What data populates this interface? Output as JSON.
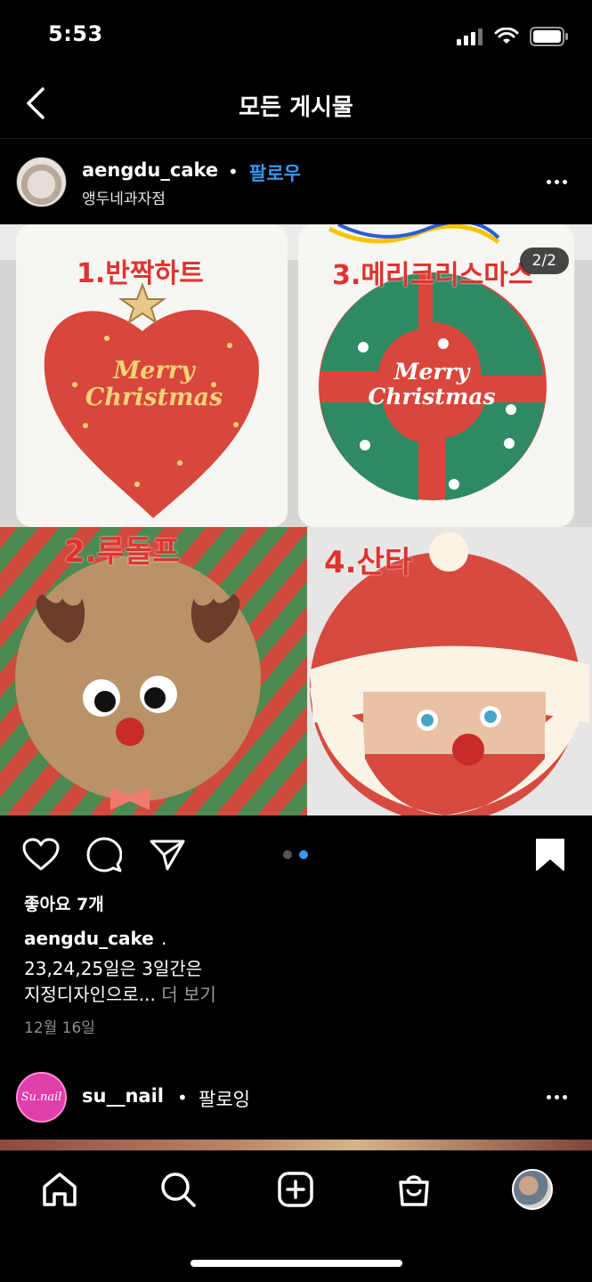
{
  "status_bar": {
    "time": "5:53"
  },
  "nav": {
    "title": "모든 게시물"
  },
  "post": {
    "username": "aengdu_cake",
    "separator": "•",
    "follow_label": "팔로우",
    "location": "앵두네과자점",
    "image": {
      "page_indicator": "2/2",
      "labels": [
        "1.반짝하트",
        "3.메리크리스마스",
        "2.루돌프",
        "4.산타"
      ],
      "cake_text_line1": "Merry",
      "cake_text_line2": "Christmas"
    },
    "carousel": {
      "total": 2,
      "active": 2
    },
    "likes": "좋아요 7개",
    "caption_username": "aengdu_cake",
    "caption_dot": ".",
    "caption_line1": "23,24,25일은 3일간은",
    "caption_line2": "지정디자인으로...",
    "more_label": " 더 보기",
    "date": "12월 16일"
  },
  "next_post": {
    "username": "su__nail",
    "separator": "•",
    "following_label": "팔로잉",
    "avatar_text": "Su.nail"
  },
  "icons": {
    "status": [
      "signal-icon",
      "wifi-icon",
      "battery-icon"
    ],
    "actions": [
      "heart-icon",
      "comment-icon",
      "share-icon",
      "bookmark-icon"
    ],
    "tabs": [
      "home-icon",
      "search-icon",
      "new-post-icon",
      "shop-icon",
      "profile-avatar"
    ]
  },
  "colors": {
    "accent_blue": "#3897f0",
    "background": "#000000",
    "label_red": "#e0332f"
  }
}
